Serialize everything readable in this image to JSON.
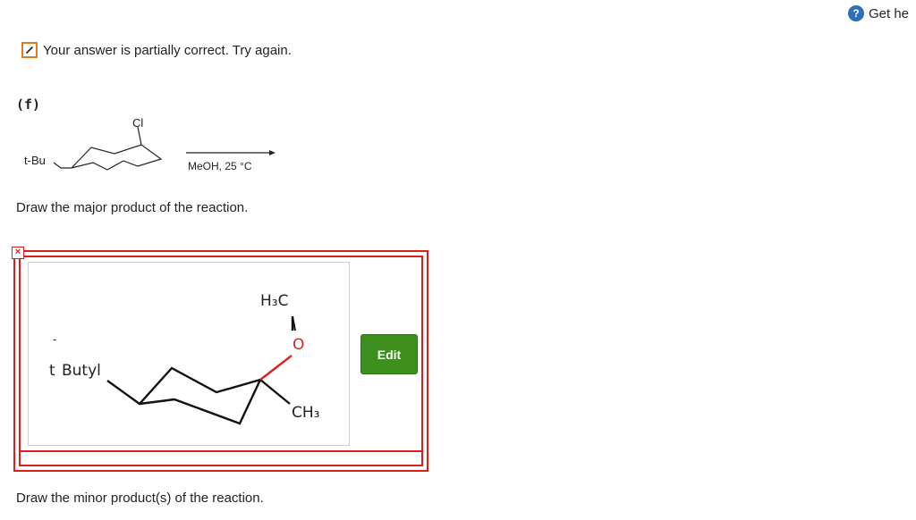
{
  "help": {
    "label": "Get he"
  },
  "status": {
    "message": "Your answer is partially correct.  Try again."
  },
  "part": {
    "label": "(f)"
  },
  "reaction": {
    "substituent_left": "t-Bu",
    "substituent_top": "Cl",
    "conditions": "MeOH, 25 °C"
  },
  "questions": {
    "major": "Draw the major product of the reaction.",
    "minor": "Draw the minor product(s) of the reaction."
  },
  "answer": {
    "status": "incorrect",
    "status_mark": "×",
    "molecule": {
      "t_label": "t",
      "bar": "-",
      "butyl_label": "Butyl",
      "h3c_label": "H₃C",
      "o_label": "O",
      "ch3_label": "CH₃"
    },
    "edit_label": "Edit"
  },
  "colors": {
    "error": "#d91e1e",
    "partial": "#e07b1f",
    "edit_button": "#3c8f1c",
    "oxygen": "#e02020",
    "help": "#2a6fb7"
  }
}
